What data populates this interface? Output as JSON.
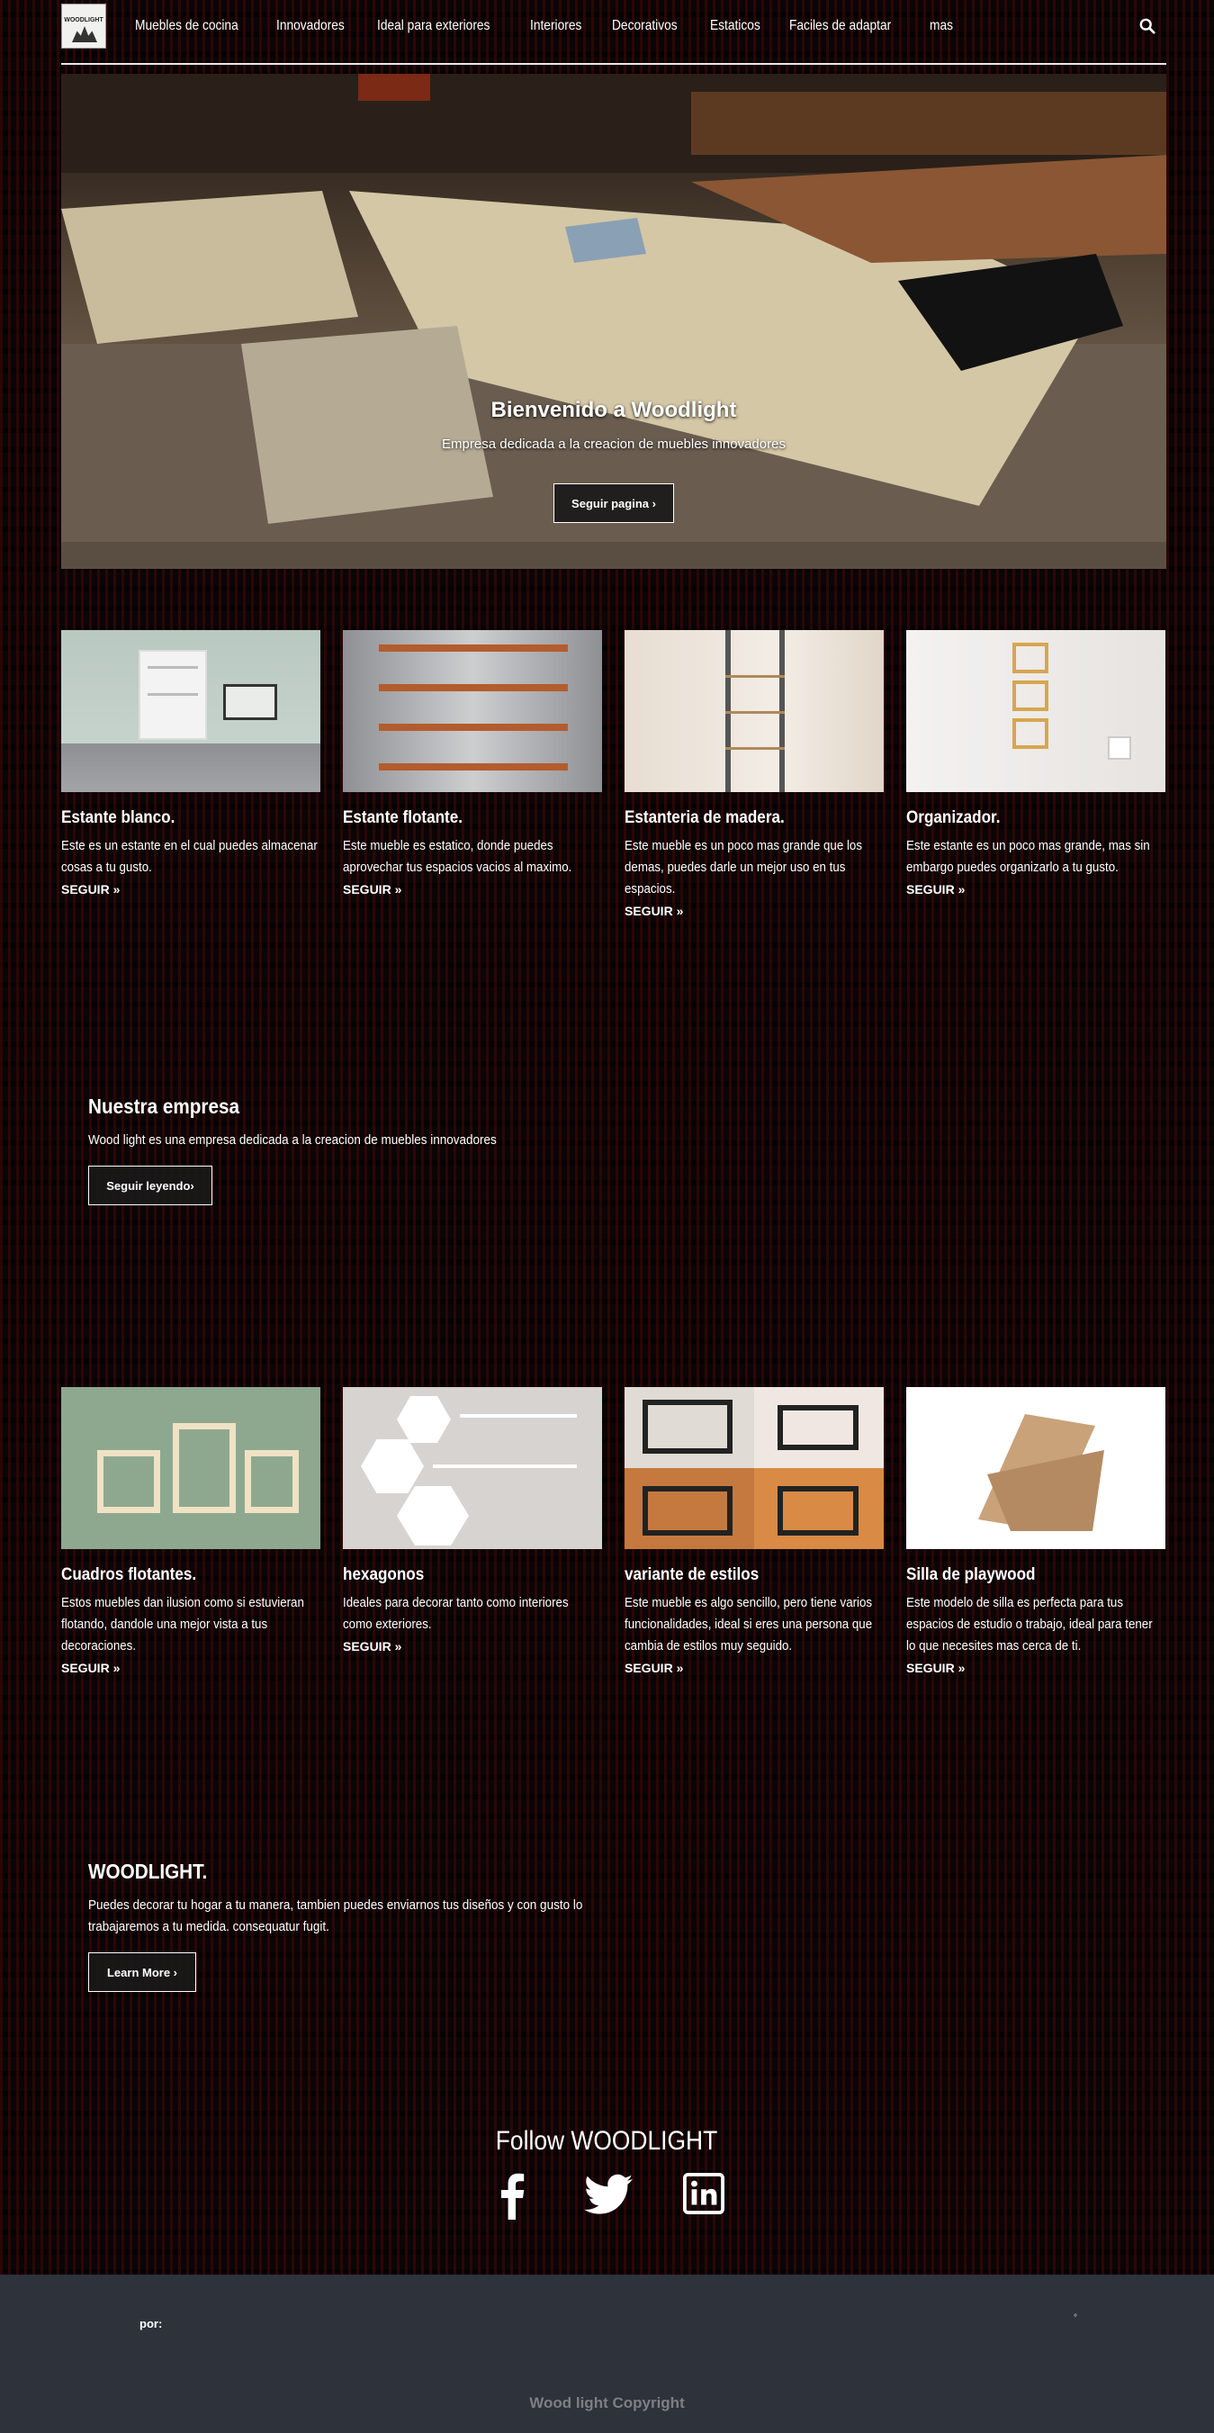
{
  "brand": {
    "logo_text": "WOODLIGHT"
  },
  "nav": {
    "items": [
      "Muebles de cocina",
      "Innovadores",
      "Ideal para exteriores",
      "Interiores",
      "Decorativos",
      "Estaticos",
      "Faciles de adaptar",
      "mas"
    ],
    "search_icon": "search-icon"
  },
  "hero": {
    "title": "Bienvenido a Woodlight",
    "subtitle": "Empresa dedicada a la creacion de muebles innovadores",
    "button": "Seguir pagina ›"
  },
  "cards_1": [
    {
      "title": "Estante blanco.",
      "text": "Este es un estante en el cual puedes almacenar cosas a tu gusto.",
      "link": "SEGUIR »"
    },
    {
      "title": "Estante flotante.",
      "text": "Este mueble es estatico, donde puedes aprovechar tus espacios vacios al maximo.",
      "link": "SEGUIR »"
    },
    {
      "title": "Estanteria de madera.",
      "text": "Este mueble es un poco mas grande que los demas, puedes darle un mejor uso en tus espacios.",
      "link": "SEGUIR »"
    },
    {
      "title": "Organizador.",
      "text": "Este estante es un poco mas grande, mas sin embargo puedes organizarlo a tu gusto.",
      "link": "SEGUIR »"
    }
  ],
  "promo_1": {
    "title": "Nuestra empresa",
    "text": "Wood light es una empresa dedicada a la creacion de muebles innovadores",
    "button": "Seguir leyendo›"
  },
  "cards_2": [
    {
      "title": "Cuadros flotantes.",
      "text": "Estos muebles dan ilusion como si estuvieran flotando, dandole una mejor vista a tus decoraciones.",
      "link": "SEGUIR »"
    },
    {
      "title": "hexagonos",
      "text": "Ideales para decorar tanto como interiores como exteriores.",
      "link": "SEGUIR »"
    },
    {
      "title": "variante de estilos",
      "text": "Este mueble es algo sencillo, pero tiene varios funcionalidades, ideal si eres una persona que cambia de estilos muy seguido.",
      "link": "SEGUIR »"
    },
    {
      "title": "Silla de playwood",
      "text": "Este modelo de silla es perfecta para tus espacios de estudio o trabajo, ideal para tener lo que necesites mas cerca de ti.",
      "link": "SEGUIR »"
    }
  ],
  "promo_2": {
    "title": "WOODLIGHT.",
    "text": "Puedes decorar tu hogar a tu manera, tambien puedes enviarnos tus diseños y con gusto lo trabajaremos a tu medida. consequatur fugit.",
    "button": "Learn More ›"
  },
  "follow": {
    "title": "Follow WOODLIGHT",
    "icons": [
      "facebook-icon",
      "twitter-icon",
      "linkedin-icon"
    ]
  },
  "footer": {
    "por": "por:",
    "dot": "°",
    "copyright": "Wood light Copyright"
  },
  "colors": {
    "footer_bg": "#2d323b",
    "page_bg": "#0b0506",
    "stripe": "#460a0c"
  }
}
